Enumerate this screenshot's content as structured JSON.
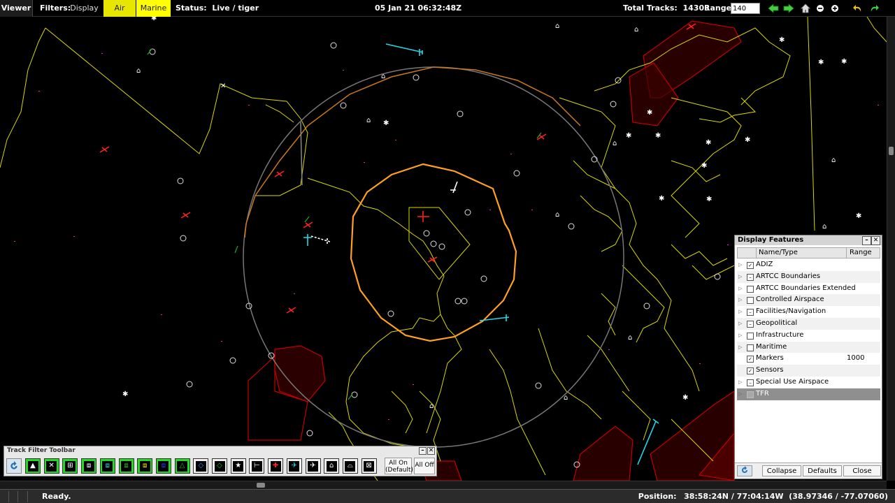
{
  "toolbar": {
    "viewer_label": "Viewer",
    "filters_label": "Filters:",
    "filter_display": "Display",
    "filter_air": "Air",
    "filter_marine": "Marine",
    "status_label": "Status:",
    "status_value": "Live / tiger",
    "clock": "05 Jan 21 06:32:48Z",
    "total_tracks_label": "Total Tracks:",
    "total_tracks_value": "14303",
    "range_label": "Range:",
    "range_value": "140"
  },
  "display_features": {
    "title": "Display Features",
    "col_name": "Name/Type",
    "col_range": "Range",
    "rows": [
      {
        "name": "ADIZ",
        "range": "",
        "check": "checked",
        "expandable": true
      },
      {
        "name": "ARTCC Boundaries",
        "range": "",
        "check": "partial",
        "expandable": true
      },
      {
        "name": "ARTCC Boundaries Extended",
        "range": "",
        "check": "unchecked",
        "expandable": true
      },
      {
        "name": "Controlled Airspace",
        "range": "",
        "check": "unchecked",
        "expandable": true
      },
      {
        "name": "Facilities/Navigation",
        "range": "",
        "check": "partial",
        "expandable": true
      },
      {
        "name": "Geopolitical",
        "range": "",
        "check": "partial",
        "expandable": true
      },
      {
        "name": "Infrastructure",
        "range": "",
        "check": "unchecked",
        "expandable": true
      },
      {
        "name": "Maritime",
        "range": "",
        "check": "unchecked",
        "expandable": true
      },
      {
        "name": "Markers",
        "range": "1000",
        "check": "checked",
        "expandable": false
      },
      {
        "name": "Sensors",
        "range": "",
        "check": "checked",
        "expandable": false
      },
      {
        "name": "Special Use Airspace",
        "range": "",
        "check": "partial",
        "expandable": true
      },
      {
        "name": "TFR",
        "range": "",
        "check": "unchecked",
        "expandable": true,
        "selected": true
      }
    ],
    "collapse_label": "Collapse",
    "defaults_label": "Defaults",
    "close_label": "Close"
  },
  "track_filter": {
    "title": "Track Filter Toolbar",
    "buttons": [
      {
        "name": "aircraft-up",
        "state": "on",
        "glyph": "▲"
      },
      {
        "name": "cross",
        "state": "on",
        "glyph": "✕"
      },
      {
        "name": "grid",
        "state": "on",
        "glyph": "⊞"
      },
      {
        "name": "box-a",
        "state": "on",
        "glyph": "⧈"
      },
      {
        "name": "box-b",
        "state": "on",
        "glyph": "⧈"
      },
      {
        "name": "box-c",
        "state": "on",
        "glyph": "⧈"
      },
      {
        "name": "box-d",
        "state": "on",
        "glyph": "⧈"
      },
      {
        "name": "box-e",
        "state": "on",
        "glyph": "⧈"
      },
      {
        "name": "triangle",
        "state": "on",
        "glyph": "△"
      },
      {
        "name": "diamond-blue",
        "state": "off",
        "glyph": "◇"
      },
      {
        "name": "diamond-green",
        "state": "off",
        "glyph": "◇"
      },
      {
        "name": "star",
        "state": "off",
        "glyph": "★"
      },
      {
        "name": "bracket",
        "state": "off",
        "glyph": "⊢"
      },
      {
        "name": "red-plus",
        "state": "off",
        "glyph": "✚"
      },
      {
        "name": "cyan-jet",
        "state": "off",
        "glyph": "✈"
      },
      {
        "name": "white-jet",
        "state": "off",
        "glyph": "✈"
      },
      {
        "name": "dome",
        "state": "off",
        "glyph": "⌂"
      },
      {
        "name": "radar",
        "state": "off",
        "glyph": "⌓"
      },
      {
        "name": "boxed-x",
        "state": "off",
        "glyph": "⊠"
      }
    ],
    "all_on_label": "All On",
    "all_on_sub": "(Default)",
    "all_off_label": "All Off"
  },
  "statusbar": {
    "ready": "Ready.",
    "position_label": "Position:",
    "position_value": "38:58:24N / 77:04:14W  (38.97346 / -77.07060)"
  }
}
